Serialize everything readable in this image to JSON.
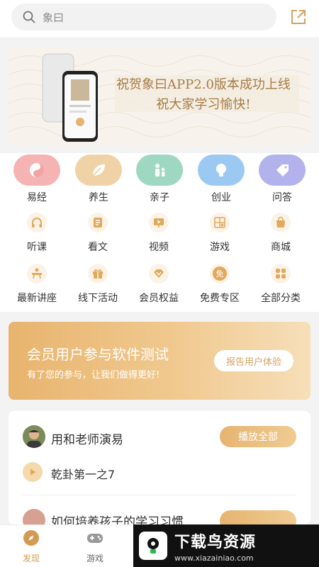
{
  "search": {
    "placeholder": "象曰"
  },
  "banner": {
    "line1": "祝贺象曰APP2.0版本成功上线",
    "line2": "祝大家学习愉快!"
  },
  "categories": [
    {
      "label": "易经",
      "icon": "yin-yang-icon",
      "color": "#f2a3a3"
    },
    {
      "label": "养生",
      "icon": "leaf-icon",
      "color": "#e8c99a"
    },
    {
      "label": "亲子",
      "icon": "parent-child-icon",
      "color": "#8fd0b8"
    },
    {
      "label": "创业",
      "icon": "lightbulb-icon",
      "color": "#8fc0ef"
    },
    {
      "label": "问答",
      "icon": "tag-icon",
      "color": "#a8a8e8"
    }
  ],
  "shortcuts": [
    {
      "label": "听课",
      "icon": "headphones-icon"
    },
    {
      "label": "看文",
      "icon": "document-icon"
    },
    {
      "label": "视频",
      "icon": "video-icon"
    },
    {
      "label": "游戏",
      "icon": "puzzle-icon"
    },
    {
      "label": "商城",
      "icon": "shopping-bag-icon"
    },
    {
      "label": "最新讲座",
      "icon": "lecture-icon"
    },
    {
      "label": "线下活动",
      "icon": "gift-icon"
    },
    {
      "label": "会员权益",
      "icon": "diamond-icon"
    },
    {
      "label": "免费专区",
      "icon": "free-badge-icon",
      "badge": "免"
    },
    {
      "label": "全部分类",
      "icon": "grid-icon"
    }
  ],
  "promo": {
    "title": "会员用户参与软件测试",
    "subtitle": "有了您的参与，让我们做得更好!",
    "button": "报告用户体验"
  },
  "course": {
    "title": "用和老师演易",
    "play_all": "播放全部",
    "lesson": "乾卦第一之7",
    "next_title": "如何培养孩子的学习习惯"
  },
  "tabs": [
    {
      "label": "发现",
      "active": true
    },
    {
      "label": "游戏",
      "active": false
    }
  ],
  "watermark": {
    "title": "下载鸟资源",
    "url": "www.xiazainiao.com"
  },
  "colors": {
    "accent": "#d4a260",
    "active_tab": "#d29a52"
  }
}
